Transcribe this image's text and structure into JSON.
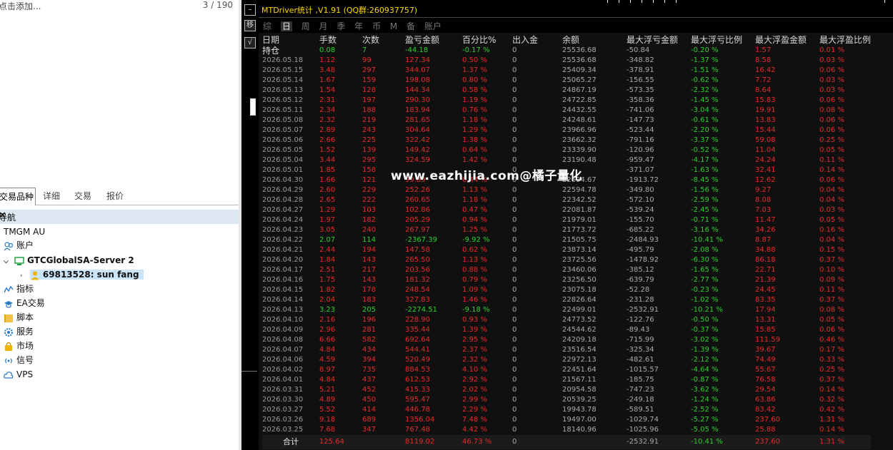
{
  "left": {
    "placeholder": "点击添加...",
    "counter": "3 / 190",
    "tabs": [
      "交易品种",
      "详细",
      "交易",
      "报价"
    ],
    "navigator_title": "导航",
    "close": "✕",
    "tree": [
      {
        "label": "TMGM AU"
      },
      {
        "label": "账户"
      },
      {
        "label": "GTCGlobalSA-Server 2"
      },
      {
        "label": "69813528: sun fang"
      },
      {
        "label": "指标"
      },
      {
        "label": "EA交易"
      },
      {
        "label": "脚本"
      },
      {
        "label": "服务"
      },
      {
        "label": "市场"
      },
      {
        "label": "信号"
      },
      {
        "label": "VPS"
      }
    ]
  },
  "right": {
    "title": "MTDriver统计 ,V1.91 (QQ群:260937757)",
    "tabs": [
      "综",
      "日",
      "周",
      "月",
      "季",
      "年",
      "币",
      "M",
      "备",
      "账户"
    ],
    "active_tab": "日",
    "watermark": "www.eazhijia.com@橘子量化",
    "headers": [
      "日期",
      "手数",
      "次数",
      "盈亏金额",
      "百分比%",
      "出入金",
      "余额",
      "最大浮亏金额",
      "最大浮亏比例",
      "最大浮盈金额",
      "最大浮盈比例"
    ],
    "rows": [
      [
        "持仓",
        "0.08",
        "7",
        "-44.18",
        "-0.17 %",
        "0",
        "25536.68",
        "-50.84",
        "-0.20 %",
        "1.57",
        "0.01 %"
      ],
      [
        "2026.05.18",
        "1.12",
        "99",
        "127.34",
        "0.50 %",
        "0",
        "25536.68",
        "-348.82",
        "-1.37 %",
        "8.58",
        "0.03 %"
      ],
      [
        "2026.05.15",
        "3.48",
        "297",
        "344.07",
        "1.37 %",
        "0",
        "25409.34",
        "-378.91",
        "-1.51 %",
        "16.42",
        "0.06 %"
      ],
      [
        "2026.05.14",
        "1.67",
        "159",
        "198.08",
        "0.80 %",
        "0",
        "25065.27",
        "-156.55",
        "-0.62 %",
        "7.72",
        "0.03 %"
      ],
      [
        "2026.05.13",
        "1.54",
        "128",
        "144.34",
        "0.58 %",
        "0",
        "24867.19",
        "-573.35",
        "-2.32 %",
        "8.64",
        "0.03 %"
      ],
      [
        "2026.05.12",
        "2.31",
        "197",
        "290.30",
        "1.19 %",
        "0",
        "24722.85",
        "-358.36",
        "-1.45 %",
        "15.83",
        "0.06 %"
      ],
      [
        "2026.05.11",
        "2.34",
        "188",
        "183.94",
        "0.76 %",
        "0",
        "24432.55",
        "-741.06",
        "-3.04 %",
        "19.91",
        "0.08 %"
      ],
      [
        "2026.05.08",
        "2.32",
        "219",
        "281.65",
        "1.18 %",
        "0",
        "24248.61",
        "-147.73",
        "-0.61 %",
        "13.83",
        "0.06 %"
      ],
      [
        "2026.05.07",
        "2.89",
        "243",
        "304.64",
        "1.29 %",
        "0",
        "23966.96",
        "-523.44",
        "-2.20 %",
        "15.44",
        "0.06 %"
      ],
      [
        "2026.05.06",
        "2.66",
        "225",
        "322.42",
        "1.38 %",
        "0",
        "23662.32",
        "-791.16",
        "-3.37 %",
        "59.08",
        "0.25 %"
      ],
      [
        "2026.05.05",
        "1.52",
        "139",
        "149.42",
        "0.64 %",
        "0",
        "23339.90",
        "-120.96",
        "-0.52 %",
        "11.04",
        "0.05 %"
      ],
      [
        "2026.05.04",
        "3.44",
        "295",
        "324.59",
        "1.42 %",
        "0",
        "23190.48",
        "-959.47",
        "-4.17 %",
        "24.24",
        "0.11 %"
      ],
      [
        "2026.05.01",
        "1.85",
        "158",
        "",
        "",
        "0",
        "",
        "-371.07",
        "-1.63 %",
        "32.41",
        "0.14 %"
      ],
      [
        "2026.04.30",
        "1.66",
        "121",
        "99.89",
        "0.44 %",
        "0",
        "22694.67",
        "-1913.72",
        "-8.45 %",
        "12.62",
        "0.06 %"
      ],
      [
        "2026.04.29",
        "2.60",
        "229",
        "252.26",
        "1.13 %",
        "0",
        "22594.78",
        "-349.80",
        "-1.56 %",
        "9.27",
        "0.04 %"
      ],
      [
        "2026.04.28",
        "2.65",
        "222",
        "260.65",
        "1.18 %",
        "0",
        "22342.52",
        "-572.10",
        "-2.59 %",
        "8.08",
        "0.04 %"
      ],
      [
        "2026.04.27",
        "1.29",
        "103",
        "102.86",
        "0.47 %",
        "0",
        "22081.87",
        "-539.24",
        "-2.45 %",
        "7.03",
        "0.03 %"
      ],
      [
        "2026.04.24",
        "1.97",
        "182",
        "205.29",
        "0.94 %",
        "0",
        "21979.01",
        "-155.70",
        "-0.71 %",
        "11.47",
        "0.05 %"
      ],
      [
        "2026.04.23",
        "3.05",
        "240",
        "267.97",
        "1.25 %",
        "0",
        "21773.72",
        "-685.22",
        "-3.16 %",
        "34.26",
        "0.16 %"
      ],
      [
        "2026.04.22",
        "2.07",
        "114",
        "-2367.39",
        "-9.92 %",
        "0",
        "21505.75",
        "-2484.93",
        "-10.41 %",
        "8.87",
        "0.04 %"
      ],
      [
        "2026.04.21",
        "2.44",
        "194",
        "147.58",
        "0.62 %",
        "0",
        "23873.14",
        "-495.79",
        "-2.08 %",
        "34.88",
        "0.15 %"
      ],
      [
        "2026.04.20",
        "1.84",
        "143",
        "265.50",
        "1.13 %",
        "0",
        "23725.56",
        "-1478.92",
        "-6.30 %",
        "86.18",
        "0.37 %"
      ],
      [
        "2026.04.17",
        "2.51",
        "217",
        "203.56",
        "0.88 %",
        "0",
        "23460.06",
        "-385.12",
        "-1.65 %",
        "22.71",
        "0.10 %"
      ],
      [
        "2026.04.16",
        "1.75",
        "143",
        "181.32",
        "0.79 %",
        "0",
        "23256.50",
        "-639.79",
        "-2.77 %",
        "21.39",
        "0.09 %"
      ],
      [
        "2026.04.15",
        "1.82",
        "178",
        "248.54",
        "1.09 %",
        "0",
        "23075.18",
        "-52.28",
        "-0.23 %",
        "24.45",
        "0.11 %"
      ],
      [
        "2026.04.14",
        "2.04",
        "183",
        "327.83",
        "1.46 %",
        "0",
        "22826.64",
        "-231.28",
        "-1.02 %",
        "83.35",
        "0.37 %"
      ],
      [
        "2026.04.13",
        "3.23",
        "205",
        "-2274.51",
        "-9.18 %",
        "0",
        "22499.01",
        "-2532.91",
        "-10.21 %",
        "17.94",
        "0.08 %"
      ],
      [
        "2026.04.10",
        "2.16",
        "196",
        "228.90",
        "0.93 %",
        "0",
        "24773.52",
        "-122.76",
        "-0.50 %",
        "13.31",
        "0.05 %"
      ],
      [
        "2026.04.09",
        "2.96",
        "281",
        "335.44",
        "1.39 %",
        "0",
        "24544.62",
        "-89.43",
        "-0.37 %",
        "15.85",
        "0.06 %"
      ],
      [
        "2026.04.08",
        "6.66",
        "582",
        "692.64",
        "2.95 %",
        "0",
        "24209.18",
        "-715.99",
        "-3.02 %",
        "111.59",
        "0.46 %"
      ],
      [
        "2026.04.07",
        "4.84",
        "434",
        "544.41",
        "2.37 %",
        "0",
        "23516.54",
        "-325.34",
        "-1.39 %",
        "39.67",
        "0.17 %"
      ],
      [
        "2026.04.06",
        "4.59",
        "394",
        "520.49",
        "2.32 %",
        "0",
        "22972.13",
        "-482.61",
        "-2.12 %",
        "74.49",
        "0.33 %"
      ],
      [
        "2026.04.02",
        "8.97",
        "735",
        "884.53",
        "4.10 %",
        "0",
        "22451.64",
        "-1015.57",
        "-4.64 %",
        "55.67",
        "0.25 %"
      ],
      [
        "2026.04.01",
        "4.84",
        "437",
        "612.53",
        "2.92 %",
        "0",
        "21567.11",
        "-185.75",
        "-0.87 %",
        "76.58",
        "0.37 %"
      ],
      [
        "2026.03.31",
        "5.21",
        "452",
        "415.33",
        "2.02 %",
        "0",
        "20954.58",
        "-747.23",
        "-3.62 %",
        "29.54",
        "0.14 %"
      ],
      [
        "2026.03.30",
        "4.89",
        "450",
        "595.47",
        "2.99 %",
        "0",
        "20539.25",
        "-249.18",
        "-1.24 %",
        "63.86",
        "0.32 %"
      ],
      [
        "2026.03.27",
        "5.52",
        "414",
        "446.78",
        "2.29 %",
        "0",
        "19943.78",
        "-589.51",
        "-2.52 %",
        "83.42",
        "0.42 %"
      ],
      [
        "2026.03.26",
        "9.18",
        "689",
        "1356.04",
        "7.48 %",
        "0",
        "19497.00",
        "-1029.74",
        "-5.27 %",
        "237.60",
        "1.31 %"
      ],
      [
        "2026.03.25",
        "7.68",
        "347",
        "767.48",
        "4.42 %",
        "0",
        "18140.96",
        "-1025.96",
        "-5.05 %",
        "25.88",
        "0.14 %"
      ]
    ],
    "total": [
      "合计",
      "125.64",
      "",
      "8119.02",
      "46.73 %",
      "0",
      "",
      "-2532.91",
      "-10.41 %",
      "237.60",
      "1.31 %"
    ],
    "colors": {
      "positive": "#e62b2b",
      "negative": "#2bd12b",
      "title": "#ffd800"
    }
  }
}
